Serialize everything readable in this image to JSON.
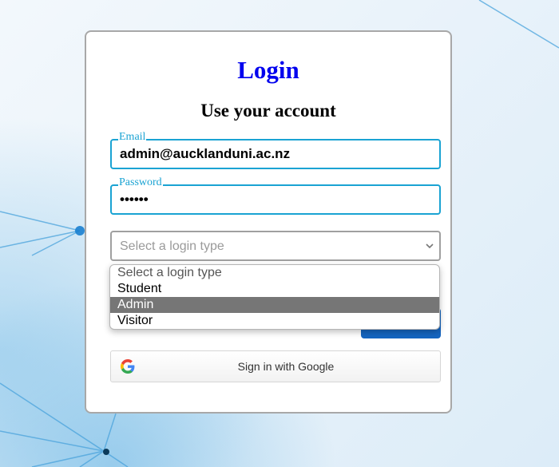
{
  "login": {
    "title": "Login",
    "subtitle": "Use your account",
    "email": {
      "label": "Email",
      "value": "admin@aucklanduni.ac.nz"
    },
    "password": {
      "label": "Password",
      "value": "••••••"
    },
    "login_type": {
      "placeholder": "Select a login type",
      "options": [
        "Select a login type",
        "Student",
        "Admin",
        "Visitor"
      ],
      "highlighted": "Admin"
    },
    "google_button": {
      "label": "Sign in with Google",
      "icon": "google-icon"
    }
  },
  "colors": {
    "title": "#0000ee",
    "field_border": "#1aa3d3",
    "primary_button": "#1565c0",
    "highlight": "#767676"
  }
}
